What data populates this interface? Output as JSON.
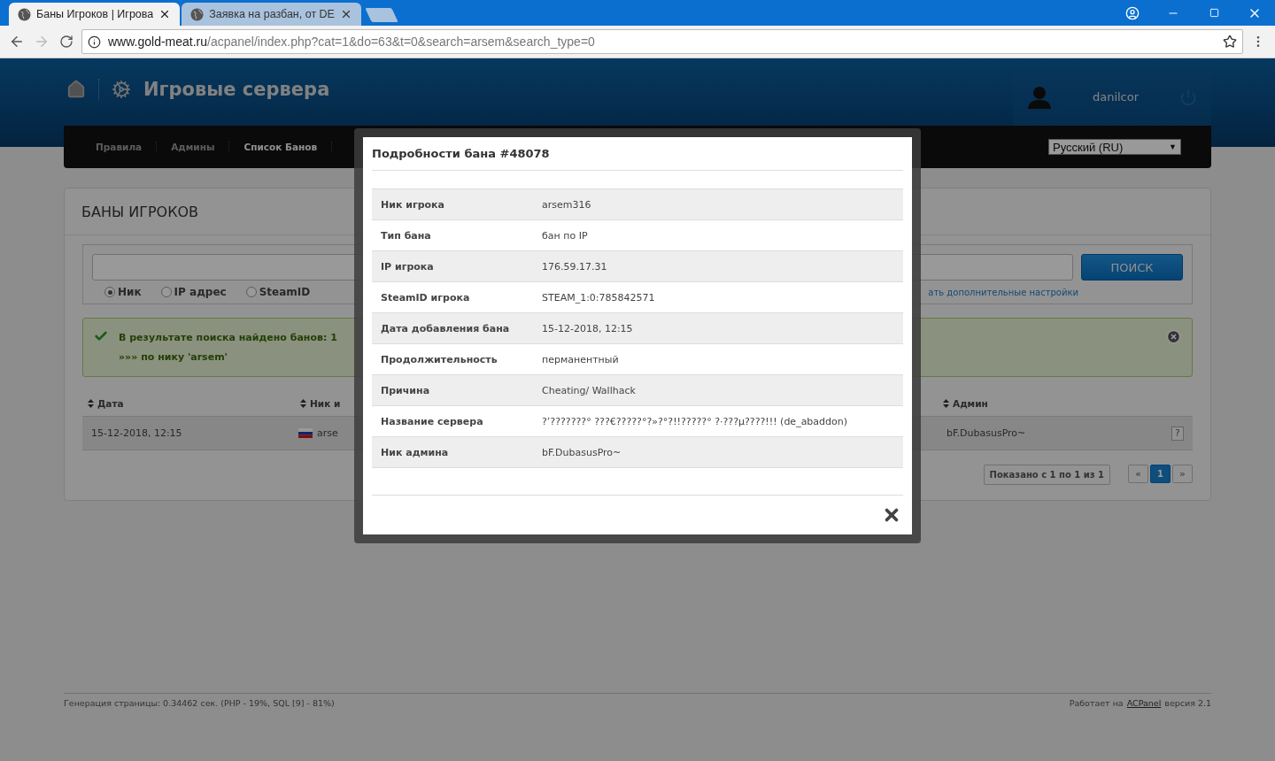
{
  "browser": {
    "tabs": [
      {
        "title": "Баны Игроков | Игрова",
        "selected": true
      },
      {
        "title": "Заявка на разбан, от DE",
        "selected": false
      }
    ],
    "address": {
      "domain": "www.gold-meat.ru",
      "path": "/acpanel/index.php?cat=1&do=63&t=0&search=arsem&search_type=0"
    }
  },
  "header": {
    "title": "Игровые сервера",
    "user": {
      "name": "danilcor"
    },
    "nav": [
      {
        "label": "Правила",
        "selected": false
      },
      {
        "label": "Админы",
        "selected": false
      },
      {
        "label": "Список Банов",
        "selected": true
      }
    ],
    "language": {
      "value": "Русский (RU)",
      "arrow": "▼"
    }
  },
  "panel": {
    "title": "БАНЫ ИГРОКОВ",
    "search": {
      "button": "ПОИСК",
      "options": [
        {
          "label": "Ник",
          "selected": true
        },
        {
          "label": "IP адрес",
          "selected": false
        },
        {
          "label": "SteamID",
          "selected": false
        }
      ],
      "link": "ать дополнительные настройки"
    },
    "alert": {
      "lines": [
        "В результате поиска найдено банов: 1",
        "»»» по нику 'arsem'"
      ]
    },
    "table": {
      "columns": [
        "Дата",
        "Ник и",
        "Админ"
      ],
      "rows": [
        {
          "date": "15-12-2018, 12:15",
          "nick": "arse",
          "admin": "bF.DubasusPro~",
          "help": "?"
        }
      ]
    },
    "pagination": {
      "info": "Показано с 1 по 1 из 1",
      "pages": [
        {
          "label": "«",
          "selected": false
        },
        {
          "label": "1",
          "selected": true
        },
        {
          "label": "»",
          "selected": false
        }
      ]
    }
  },
  "footer": {
    "left": "Генерация страницы: 0.34462 сек. (PHP - 19%, SQL [9] - 81%)",
    "right_prefix": "Работает на",
    "right_link": "ACPanel",
    "right_suffix": "версия 2.1"
  },
  "modal": {
    "title": "Подробности бана #48078",
    "rows": [
      {
        "label": "Ник игрока",
        "value": "arsem316"
      },
      {
        "label": "Тип бана",
        "value": "бан по IP"
      },
      {
        "label": "IP игрока",
        "value": "176.59.17.31"
      },
      {
        "label": "SteamID игрока",
        "value": "STEAM_1:0:785842571"
      },
      {
        "label": "Дата добавления бана",
        "value": "15-12-2018, 12:15"
      },
      {
        "label": "Продолжительность",
        "value": "перманентный"
      },
      {
        "label": "Причина",
        "value": "Cheating/ Wallhack"
      },
      {
        "label": "Название сервера",
        "value": "?’???????° ???€?????°?»?°?!!?????° ?·???µ????!!! (de_abaddon)"
      },
      {
        "label": "Ник админа",
        "value": "bF.DubasusPro~"
      }
    ]
  }
}
